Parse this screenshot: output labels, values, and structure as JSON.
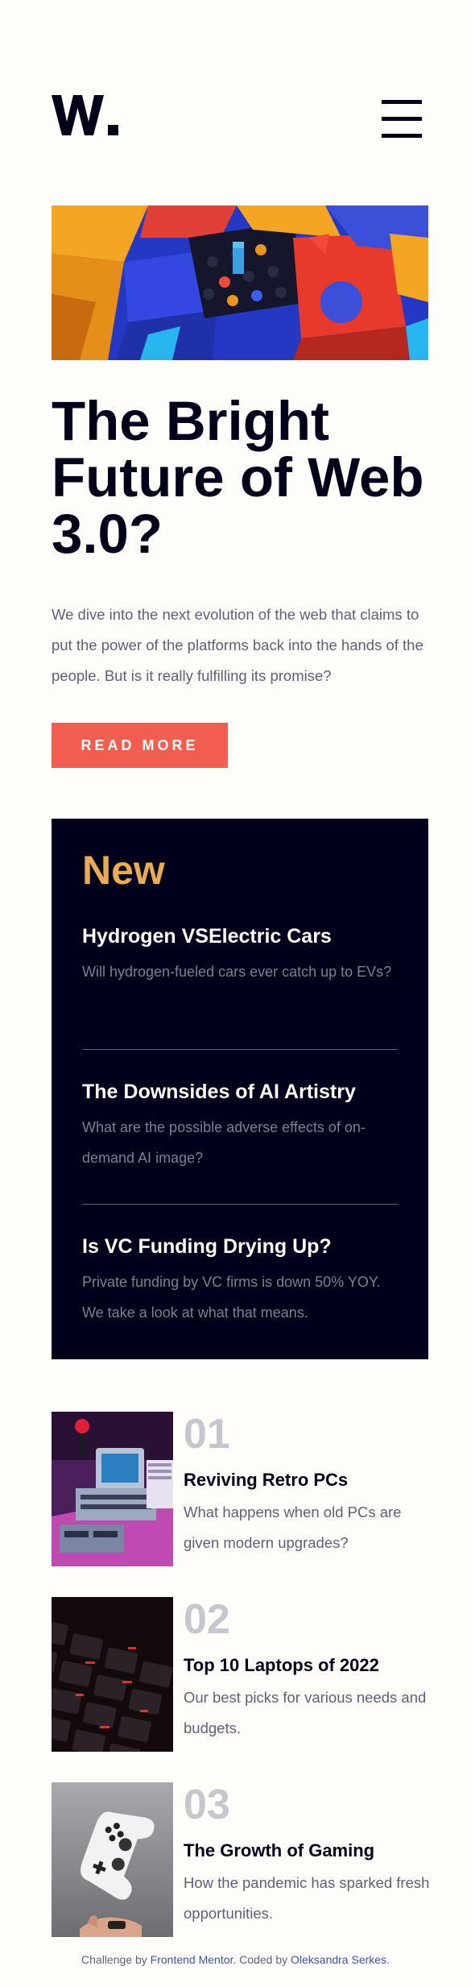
{
  "header": {
    "logo_text": "W.",
    "menu_icon": "hamburger-menu-icon"
  },
  "hero": {
    "image_icon": "abstract-3d-blocks-image",
    "title": "The Bright Future of Web 3.0?",
    "description": "We dive into the next evolution of the web that claims to put the power of the platforms back into the hands of the people. But is it really fulfilling its promise?",
    "button_label": "READ MORE"
  },
  "new_section": {
    "heading": "New",
    "items": [
      {
        "title": "Hydrogen VSElectric Cars",
        "text": "Will hydrogen-fueled cars ever catch up to EVs?"
      },
      {
        "title": "The Downsides of AI Artistry",
        "text": "What are the possible adverse effects of on-demand AI image?"
      },
      {
        "title": "Is VC Funding Drying Up?",
        "text": "Private funding by VC firms is down 50% YOY. We take a look at what that means."
      }
    ]
  },
  "articles": [
    {
      "number": "01",
      "title": "Reviving Retro PCs",
      "text": "What happens when old PCs are given modern upgrades?",
      "image_icon": "retro-pc-image"
    },
    {
      "number": "02",
      "title": "Top 10 Laptops of 2022",
      "text": "Our best picks for various needs and budgets.",
      "image_icon": "laptop-keyboard-image"
    },
    {
      "number": "03",
      "title": "The Growth of Gaming",
      "text": "How the pandemic has sparked fresh opportunities.",
      "image_icon": "game-controller-image"
    }
  ],
  "footer": {
    "prefix": "Challenge by ",
    "link1": "Frontend Mentor",
    "middle": ". Coded by ",
    "link2": "Oleksandra Serkes",
    "suffix": "."
  },
  "colors": {
    "accent": "#f15e50",
    "new_heading": "#e9ab53",
    "dark": "#00001a",
    "text_muted": "#5d5f79",
    "number": "#c5c6ce",
    "background": "#fffdfa"
  }
}
